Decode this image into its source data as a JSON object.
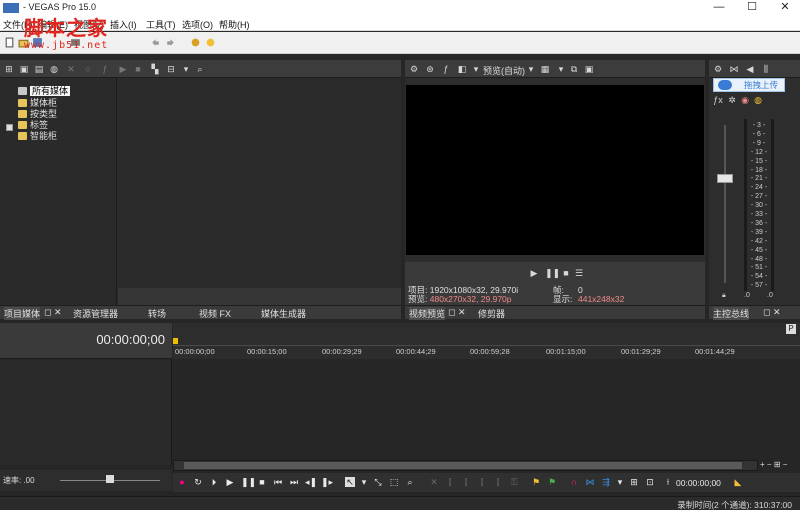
{
  "window": {
    "title": "- VEGAS Pro 15.0",
    "minimize": "—",
    "maximize": "☐",
    "close": "✕"
  },
  "menu": {
    "items": [
      {
        "label": "文件(F)"
      },
      {
        "label": "编辑(E)"
      },
      {
        "label": "视图(V)"
      },
      {
        "label": "插入(I)"
      },
      {
        "label": "工具(T)"
      },
      {
        "label": "选项(O)"
      },
      {
        "label": "帮助(H)"
      }
    ]
  },
  "watermark": {
    "line1": "脚本之家",
    "line2": "www.jb51.net"
  },
  "media_tree": {
    "nodes": [
      {
        "label": "所有媒体"
      },
      {
        "label": "媒体柜"
      },
      {
        "label": "按类型"
      },
      {
        "label": "标签"
      },
      {
        "label": "智能柜"
      }
    ]
  },
  "media_tabs": [
    {
      "label": "项目媒体"
    },
    {
      "label": "资源管理器"
    },
    {
      "label": "转场"
    },
    {
      "label": "视频 FX"
    },
    {
      "label": "媒体生成器"
    }
  ],
  "preview": {
    "quality": "预览(自动)",
    "info": {
      "project_label": "项目:",
      "project_value": "1920x1080x32, 29.970i",
      "frame_label": "帧:",
      "frame_value": "0",
      "preview_label": "预览:",
      "preview_value": "480x270x32, 29.970p",
      "display_label": "显示:",
      "display_value": "441x248x32"
    },
    "tabs": [
      {
        "label": "视频预览"
      },
      {
        "label": "修剪器"
      }
    ]
  },
  "master_bus": {
    "tooltip": "拖拽上传",
    "scale": [
      "3",
      "6",
      "9",
      "12",
      "15",
      "18",
      "21",
      "24",
      "27",
      "30",
      "33",
      "36",
      "39",
      "42",
      "45",
      "48",
      "51",
      "54",
      "57"
    ],
    "left_value": ".0",
    "right_value": ".0",
    "tab": "主控总线"
  },
  "timeline": {
    "timecode": "00:00:00;00",
    "ruler_labels": [
      "00:00:00;00",
      "00:00:15;00",
      "00:00:29;29",
      "00:00:44;29",
      "00:00:59;28",
      "00:01:15;00",
      "00:01:29;29",
      "00:01:44;29"
    ],
    "rate_label": "速率: .00",
    "transport_time": "00:00:00;00"
  },
  "status": {
    "text": "录制时间(2 个通道): 310:37:00"
  },
  "colors": {
    "folder": "#e8c35a",
    "accent_red": "#f28a8a",
    "watermark_red": "#e0241e",
    "cursor_yellow": "#f0c000"
  }
}
